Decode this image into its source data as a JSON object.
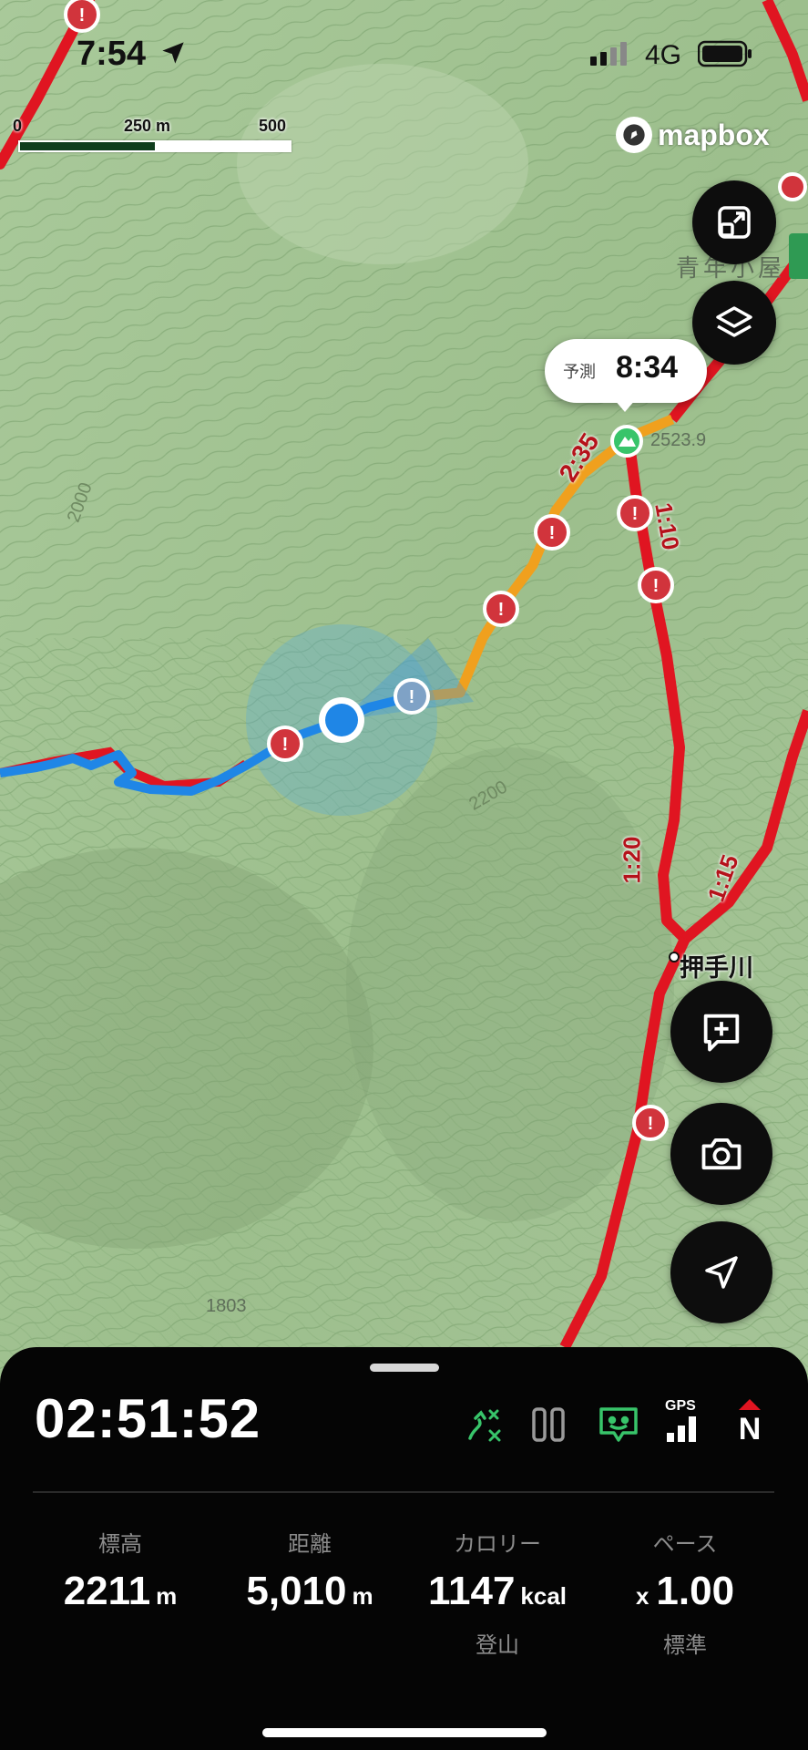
{
  "status_bar": {
    "time": "7:54",
    "network": "4G"
  },
  "scale": {
    "zero": "0",
    "mid": "250 m",
    "end": "500 m"
  },
  "attribution": "mapbox",
  "prediction": {
    "label": "予測",
    "time": "8:34"
  },
  "map_labels": {
    "seg1": "2:35",
    "seg2": "1:10",
    "seg3": "1:20",
    "seg4": "1:15",
    "place": "押手川",
    "hut": "青年小屋",
    "peak_elev": "2523.9",
    "spot_elev": "1803",
    "contour_2200": "2200",
    "contour_2000": "2000"
  },
  "panel": {
    "elapsed": "02:51:52",
    "gps_label": "GPS",
    "north_label": "N",
    "stats": [
      {
        "label": "標高",
        "value": "2211",
        "unit": "m",
        "sub": ""
      },
      {
        "label": "距離",
        "value": "5,010",
        "unit": "m",
        "sub": ""
      },
      {
        "label": "カロリー",
        "value": "1147",
        "unit": "kcal",
        "sub": "登山"
      },
      {
        "label": "ペース",
        "value": "1.00",
        "prefix": "x",
        "sub": "標準"
      }
    ]
  },
  "colors": {
    "route_red": "#e01521",
    "route_orange": "#f0a01e",
    "track_blue": "#1f86e6",
    "accent_green": "#38c46a"
  }
}
